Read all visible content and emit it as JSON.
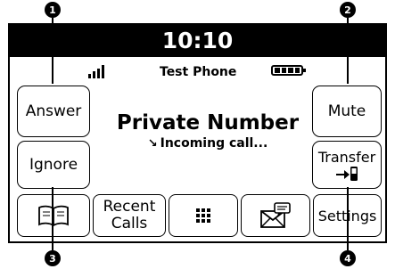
{
  "callouts": [
    "1",
    "2",
    "3",
    "4"
  ],
  "clock": {
    "time": "10:10"
  },
  "status_bar": {
    "carrier": "Test Phone",
    "signal_icon": "signal-strength-icon",
    "battery_icon": "battery-icon"
  },
  "call": {
    "caller": "Private Number",
    "status": "Incoming call...",
    "status_icon": "incoming-call-arrow-icon"
  },
  "side_buttons": {
    "answer": "Answer",
    "ignore": "Ignore",
    "mute": "Mute",
    "transfer": "Transfer",
    "transfer_icon": "transfer-to-handset-icon"
  },
  "bottom_bar": {
    "phonebook_icon": "phonebook-icon",
    "recent_calls": "Recent Calls",
    "keypad_icon": "keypad-icon",
    "messages_icon": "messages-icon",
    "settings": "Settings"
  }
}
